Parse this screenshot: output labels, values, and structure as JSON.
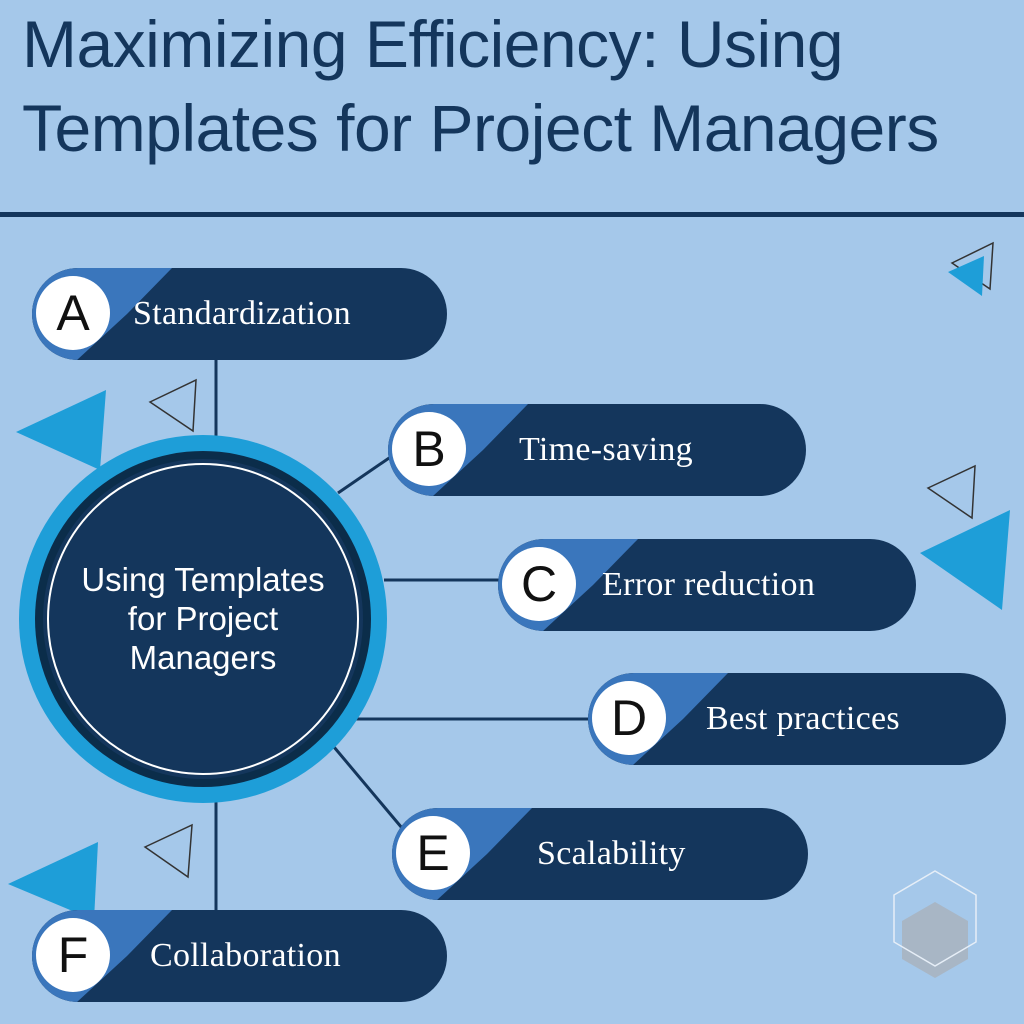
{
  "header": {
    "title_line1": "Maximizing Efficiency: Using",
    "title_line2": "Templates for Project Managers"
  },
  "hub": {
    "line1": "Using Templates",
    "line2": "for Project",
    "line3": "Managers"
  },
  "items": [
    {
      "letter": "A",
      "label": "Standardization"
    },
    {
      "letter": "B",
      "label": "Time-saving"
    },
    {
      "letter": "C",
      "label": "Error reduction"
    },
    {
      "letter": "D",
      "label": "Best practices"
    },
    {
      "letter": "E",
      "label": "Scalability"
    },
    {
      "letter": "F",
      "label": "Collaboration"
    }
  ],
  "colors": {
    "background": "#a5c8ea",
    "navy": "#14365c",
    "accent_blue": "#1e9ed8",
    "wedge_blue": "#3a76bc"
  }
}
